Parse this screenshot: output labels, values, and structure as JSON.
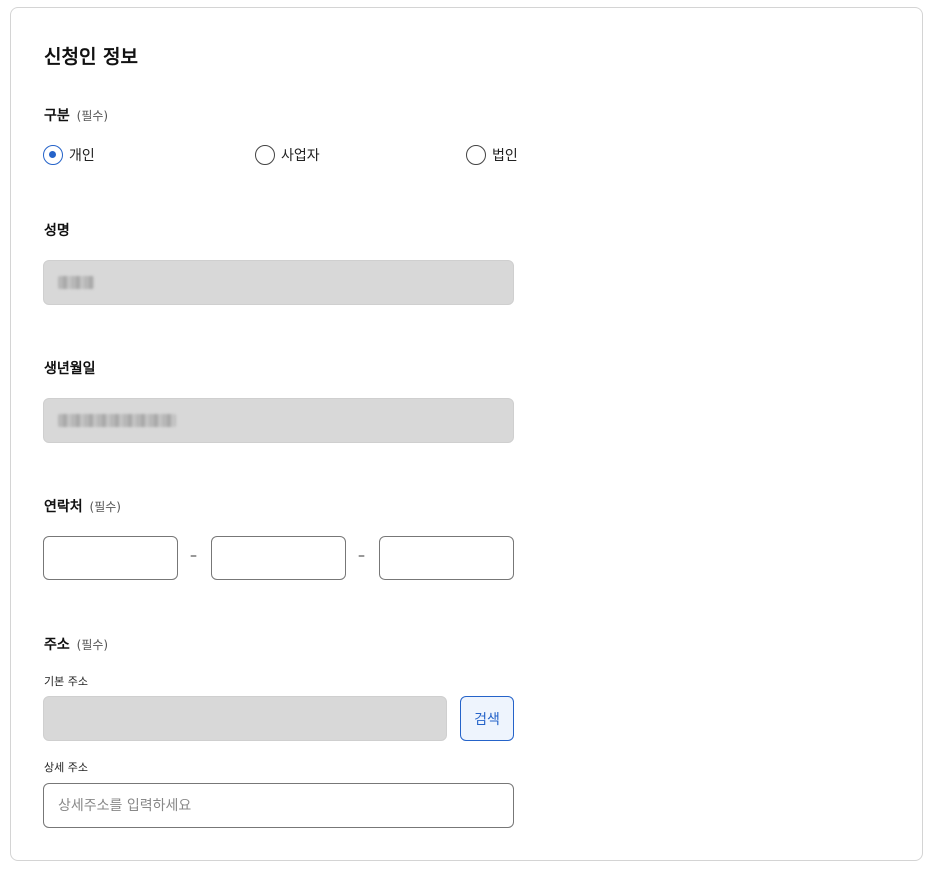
{
  "section": {
    "title": "신청인 정보"
  },
  "type": {
    "label": "구분",
    "required": "(필수)",
    "options": [
      {
        "label": "개인",
        "checked": true
      },
      {
        "label": "사업자",
        "checked": false
      },
      {
        "label": "법인",
        "checked": false
      }
    ]
  },
  "name": {
    "label": "성명"
  },
  "birth": {
    "label": "생년월일"
  },
  "contact": {
    "label": "연락처",
    "required": "(필수)",
    "separator": "–",
    "parts": [
      "",
      "",
      ""
    ]
  },
  "address": {
    "label": "주소",
    "required": "(필수)",
    "basic_label": "기본 주소",
    "basic_value": "",
    "search_button": "검색",
    "detail_label": "상세 주소",
    "detail_placeholder": "상세주소를 입력하세요",
    "detail_value": ""
  },
  "colors": {
    "accent": "#2563c9",
    "readonly_bg": "#d8d8d8",
    "border": "#777777"
  }
}
